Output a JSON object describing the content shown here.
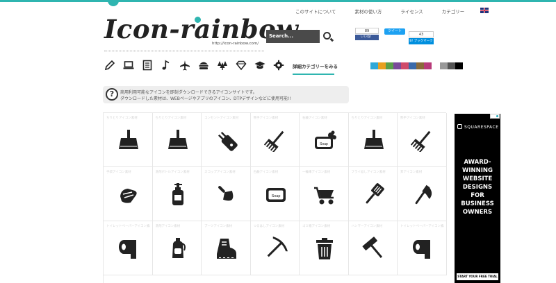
{
  "site": {
    "logo_text": "Icon-rainbow",
    "url_text": "http://icon-rainbow.com/"
  },
  "nav": {
    "items": [
      "このサイトについて",
      "素材の使い方",
      "ライセンス",
      "カテゴリー"
    ],
    "language_flag": "uk-flag-icon"
  },
  "search": {
    "label": "Search..."
  },
  "social": {
    "facebook_count": "89",
    "facebook_label": "いいね！",
    "tweet_label": "ツイート",
    "hatena_count": "43",
    "hatena_label": "B! ブックマーク"
  },
  "categories": {
    "icons": [
      "pencil-icon",
      "laptop-icon",
      "document-icon",
      "music-note-icon",
      "airplane-icon",
      "hamburger-icon",
      "trees-icon",
      "diamond-icon",
      "graduation-cap-icon",
      "gear-icon"
    ],
    "more_label": "詳細カテゴリーをみる"
  },
  "color_filters": [
    "#2fa8d8",
    "#e8a020",
    "#5a9f4a",
    "#7a4a9a",
    "#d04a6a",
    "#3a6aaa",
    "#8a6a3a",
    "#b83a7a"
  ],
  "mono_filters": [
    "#999999",
    "#555555",
    "#000000"
  ],
  "info": {
    "line1": "商用利用可能なアイコンを即刻ダウンロードできるアイコンサイトです。",
    "line2": "ダウンロードした素材は、WEBページやアプリのアイコン、DTPデザインなどに使用可能!!"
  },
  "grid": {
    "rows": [
      [
        {
          "caption": "ちりとりアイコン素材",
          "icon": "dustpan-icon"
        },
        {
          "caption": "ちりとりアイコン素材",
          "icon": "dustpan-icon"
        },
        {
          "caption": "コンセントアイコン素材",
          "icon": "plug-icon"
        },
        {
          "caption": "熊手アイコン素材",
          "icon": "rake-icon"
        },
        {
          "caption": "石鹸アイコン素材",
          "icon": "soap-foam-icon"
        },
        {
          "caption": "ちりとりアイコン素材",
          "icon": "dustpan-icon"
        },
        {
          "caption": "熊手アイコン素材",
          "icon": "rake-icon"
        }
      ],
      [
        {
          "caption": "手袋アイコン素材",
          "icon": "gloves-icon"
        },
        {
          "caption": "洗剤ボトルアイコン素材",
          "icon": "pump-bottle-icon"
        },
        {
          "caption": "スコップアイコン素材",
          "icon": "trowel-icon"
        },
        {
          "caption": "石鹸アイコン素材",
          "icon": "soap-icon"
        },
        {
          "caption": "一輪車アイコン素材",
          "icon": "wheelbarrow-icon"
        },
        {
          "caption": "フライ返しアイコン素材",
          "icon": "spatula-icon"
        },
        {
          "caption": "斧アイコン素材",
          "icon": "axe-icon"
        }
      ],
      [
        {
          "caption": "トイレットペーパーアイコン素材",
          "icon": "toilet-paper-icon"
        },
        {
          "caption": "洗剤アイコン素材",
          "icon": "detergent-icon"
        },
        {
          "caption": "ブーツアイコン素材",
          "icon": "boot-icon"
        },
        {
          "caption": "つるはしアイコン素材",
          "icon": "pickaxe-icon"
        },
        {
          "caption": "ゴミ箱アイコン素材",
          "icon": "trash-can-icon"
        },
        {
          "caption": "ハンマーアイコン素材",
          "icon": "hammer-icon"
        },
        {
          "caption": "トイレットペーパーアイコン素材",
          "icon": "toilet-paper-icon"
        }
      ]
    ]
  },
  "ad": {
    "brand": "SQUARESPACE",
    "headline": [
      "AWARD-",
      "WINNING",
      "WEBSITE",
      "DESIGNS",
      "FOR",
      "BUSINESS",
      "OWNERS"
    ],
    "cta": "START YOUR FREE TRIAL"
  }
}
